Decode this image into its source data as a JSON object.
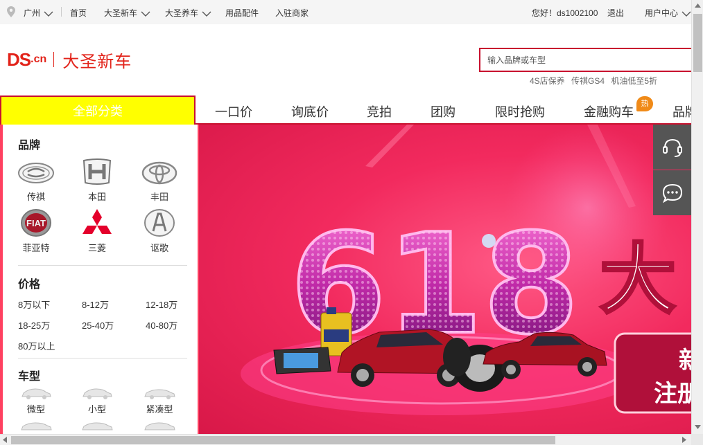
{
  "topbar": {
    "city": "广州",
    "links": [
      "首页",
      "大圣新车",
      "大圣养车",
      "用品配件",
      "入驻商家"
    ],
    "greeting": "您好！ds1002100",
    "logout": "退出",
    "user_center": "用户中心"
  },
  "header": {
    "logo_ds": "DS",
    "logo_cn": ".cn",
    "site_name": "大圣新车",
    "search_placeholder": "输入品牌或车型",
    "hot_words": [
      "4S店保养",
      "传祺GS4",
      "机油低至5折"
    ]
  },
  "nav": {
    "all_categories": "全部分类",
    "items": [
      "一口价",
      "询底价",
      "竞拍",
      "团购",
      "限时抢购",
      "金融购车",
      "品牌"
    ],
    "hot_badge": "热"
  },
  "sidebar": {
    "brand_title": "品牌",
    "brands": [
      "传祺",
      "本田",
      "丰田",
      "菲亚特",
      "三菱",
      "讴歌"
    ],
    "price_title": "价格",
    "prices": [
      "8万以下",
      "8-12万",
      "12-18万",
      "18-25万",
      "25-40万",
      "40-80万",
      "80万以上"
    ],
    "type_title": "车型",
    "types": [
      "微型",
      "小型",
      "紧凑型"
    ]
  },
  "banner": {
    "big_number": "618",
    "big_text": "大",
    "line1": "新",
    "line2": "注册"
  },
  "colors": {
    "brand_red": "#c8102e",
    "allcat_bg": "#ffff00",
    "banner_pink": "#f22a5e"
  },
  "icons": {
    "location": "location-pin-icon",
    "headset": "headset-icon",
    "chat": "chat-bubble-icon"
  }
}
